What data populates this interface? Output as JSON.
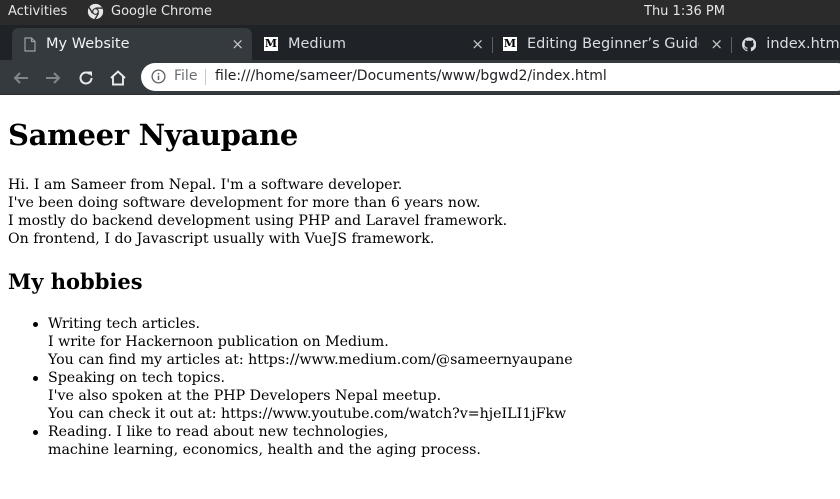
{
  "system_bar": {
    "activities": "Activities",
    "app_name": "Google Chrome",
    "clock": "Thu  1:36 PM"
  },
  "tabs": [
    {
      "title": "My Website",
      "favicon": "document-icon",
      "active": true
    },
    {
      "title": "Medium",
      "favicon": "medium-logo-icon",
      "active": false
    },
    {
      "title": "Editing Beginner’s Guide",
      "favicon": "medium-logo-icon",
      "active": false
    },
    {
      "title": "index.html",
      "favicon": "github-icon",
      "active": false
    }
  ],
  "favicon_letter": "M",
  "close_glyph": "×",
  "omnibox": {
    "scheme_label": "File",
    "url": "file:///home/sameer/Documents/www/bgwd2/index.html"
  },
  "page": {
    "heading": "Sameer Nyaupane",
    "intro_lines": [
      "Hi. I am Sameer from Nepal. I'm a software developer.",
      "I've been doing software development for more than 6 years now.",
      "I mostly do backend development using PHP and Laravel framework.",
      "On frontend, I do Javascript usually with VueJS framework."
    ],
    "subheading": "My hobbies",
    "hobbies": [
      {
        "lines": [
          "Writing tech articles.",
          "I write for Hackernoon publication on Medium.",
          "You can find my articles at: https://www.medium.com/@sameernyaupane"
        ]
      },
      {
        "lines": [
          "Speaking on tech topics.",
          "I've also spoken at the PHP Developers Nepal meetup.",
          "You can check it out at: https://www.youtube.com/watch?v=hjeILI1jFkw"
        ]
      },
      {
        "lines": [
          "Reading. I like to read about new technologies,",
          "machine learning, economics, health and the aging process."
        ]
      }
    ]
  },
  "colors": {
    "topbar": "#2b2b2b",
    "tabstrip": "#1f2327",
    "active_tab": "#353a3f",
    "toolbar": "#353a3f"
  }
}
